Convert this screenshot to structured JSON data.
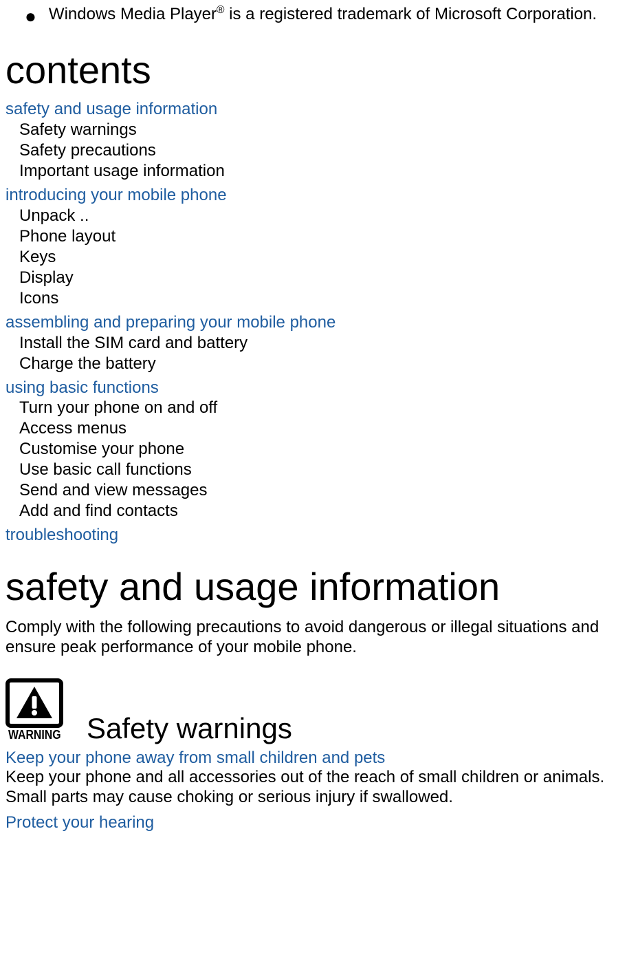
{
  "trademark": {
    "prefix": "Windows Media Player",
    "sup": "®",
    "suffix": " is a registered trademark of Microsoft Corporation."
  },
  "headings": {
    "contents": "contents",
    "safety_and_usage": "safety and usage information",
    "safety_warnings": "Safety warnings"
  },
  "toc": {
    "s1": {
      "title": "safety and usage information",
      "i0": "Safety warnings",
      "i1": "Safety precautions",
      "i2": "Important usage information"
    },
    "s2": {
      "title": "introducing your mobile phone",
      "i0": "Unpack  ..",
      "i1": "Phone layout",
      "i2": "Keys",
      "i3": "Display",
      "i4": "Icons"
    },
    "s3": {
      "title": "assembling and preparing your mobile phone",
      "i0": "Install the SIM card and battery",
      "i1": "Charge the battery"
    },
    "s4": {
      "title": "using basic functions",
      "i0": "Turn your phone on and off",
      "i1": "Access menus",
      "i2": "Customise your phone",
      "i3": "Use basic call functions",
      "i4": "Send and view messages",
      "i5": "Add and find contacts"
    },
    "s5": {
      "title": "troubleshooting"
    }
  },
  "safety_intro": "Comply with the following precautions to avoid dangerous or illegal situations and ensure peak performance of your mobile phone.",
  "warning_label": "WARNING",
  "subsections": {
    "keep_away_title": "Keep your phone away from small children and pets",
    "keep_away_body": "Keep your phone and all accessories out of the reach of small children or animals. Small parts may cause choking or serious injury if swallowed.",
    "protect_hearing_title": "Protect your hearing"
  }
}
